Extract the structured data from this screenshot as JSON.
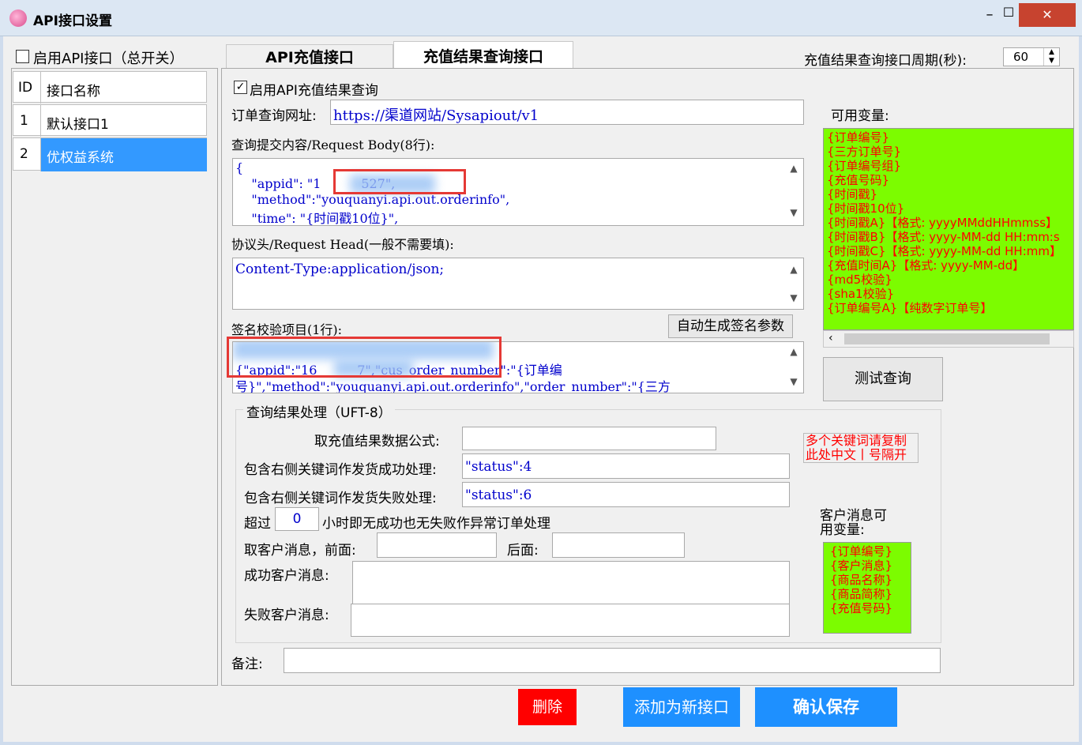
{
  "window": {
    "title": "API接口设置",
    "minimize": "–",
    "maximize": "☐",
    "close": "✕"
  },
  "master_switch": {
    "label": "启用API接口（总开关）",
    "checked": false
  },
  "list": {
    "headers": [
      "ID",
      "接口名称"
    ],
    "rows": [
      {
        "id": "1",
        "name": "默认接口1"
      },
      {
        "id": "2",
        "name": "优权益系统"
      }
    ]
  },
  "tabs": [
    {
      "label": "API充值接口"
    },
    {
      "label": "充值结果查询接口"
    }
  ],
  "period": {
    "label": "充值结果查询接口周期(秒):",
    "value": "60"
  },
  "enable_query": {
    "label": "启用API充值结果查询",
    "checked": true
  },
  "order_url": {
    "label": "订单查询网址:",
    "value": "https://渠道网站/Sysapiout/v1"
  },
  "body": {
    "label": "查询提交内容/Request Body(8行):",
    "lines": [
      "{",
      "    \"appid\": \"1          527\",",
      "    \"method\":\"youquanyi.api.out.orderinfo\",",
      "    \"time\": \"{时间戳10位}\","
    ]
  },
  "head": {
    "label": "协议头/Request Head(一般不需要填):",
    "value": "Content-Type:application/json;"
  },
  "sign": {
    "label": "签名校验项目(1行):",
    "auto_button": "自动生成签名参数",
    "lines": [
      "{\"appid\":\"16          7\",\"cus_order_number\":\"{订单编",
      "号}\",\"method\":\"youquanyi.api.out.orderinfo\",\"order_number\":\"{三方"
    ]
  },
  "variables": {
    "label": "可用变量:",
    "items": [
      "{订单编号}",
      "{三方订单号}",
      "{订单编号组}",
      "{充值号码}",
      "{时间戳}",
      "{时间戳10位}",
      "{时间戳A}【格式: yyyyMMddHHmmss】",
      "{时间戳B}【格式: yyyy-MM-dd HH:mm:s",
      "{时间戳C}【格式: yyyy-MM-dd HH:mm】",
      "{充值时间A}【格式: yyyy-MM-dd】",
      "{md5校验}",
      "{sha1校验}",
      "{订单编号A}【纯数字订单号】"
    ]
  },
  "test_button": "测试查询",
  "result": {
    "group_label": "查询结果处理（UFT-8）",
    "formula_label": "取充值结果数据公式:",
    "formula_value": "",
    "success_label": "包含右侧关键词作发货成功处理:",
    "success_value": "\"status\":4",
    "fail_label": "包含右侧关键词作发货失败处理:",
    "fail_value": "\"status\":6",
    "timeout_prefix": "超过",
    "timeout_value": "0",
    "timeout_suffix": "小时即无成功也无失败作异常订单处理",
    "cust_msg_label": "取客户消息，前面:",
    "cust_msg_front": "",
    "cust_msg_back_label": "后面:",
    "cust_msg_back": "",
    "success_msg_label": "成功客户消息:",
    "fail_msg_label": "失败客户消息:",
    "keyword_note": "多个关键词请复制此处中文丨号隔开"
  },
  "cust_vars": {
    "label": "客户消息可用变量:",
    "items": [
      "{订单编号}",
      "{客户消息}",
      "{商品名称}",
      "{商品简称}",
      "{充值号码}"
    ]
  },
  "remark": {
    "label": "备注:",
    "value": ""
  },
  "buttons": {
    "delete": "删除",
    "add_new": "添加为新接口",
    "save": "确认保存"
  },
  "colors": {
    "green": "#7cfc00",
    "red_text": "#ff0000",
    "delete_bg": "#ff0000",
    "blue_btn": "#1e90ff",
    "selected_row": "#3399ff"
  }
}
